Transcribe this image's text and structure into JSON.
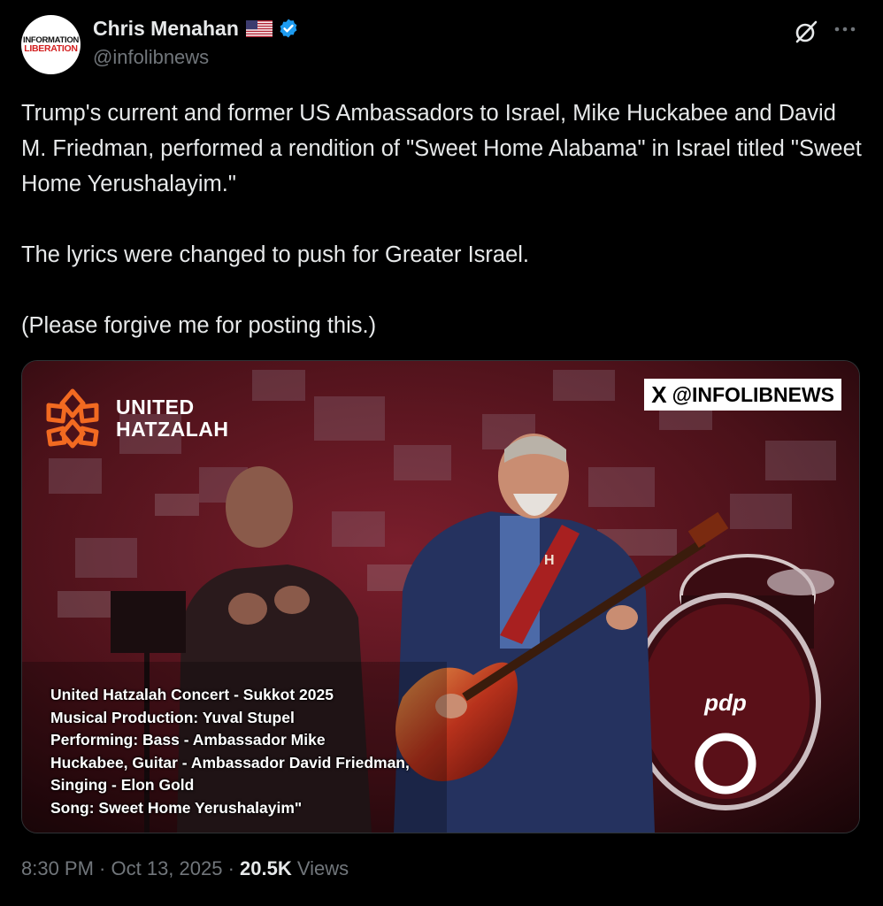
{
  "author": {
    "display_name": "Chris Menahan",
    "handle": "@infolibnews",
    "avatar_line1": "INFORMATION",
    "avatar_line2": "LIBERATION"
  },
  "tweet": {
    "text": "Trump's current and former US Ambassadors to Israel, Mike Huckabee and David M. Friedman, performed a rendition of \"Sweet Home Alabama\" in Israel titled \"Sweet Home Yerushalayim.\"\n\nThe lyrics were changed to push for Greater Israel.\n\n(Please forgive me for posting this.)"
  },
  "media": {
    "brand_line1": "UNITED",
    "brand_line2": "HATZALAH",
    "watermark": "@INFOLIBNEWS",
    "watermark_logo": "X",
    "drum_brand": "pdp",
    "strap_letter": "H",
    "caption_lines": [
      "United Hatzalah Concert - Sukkot 2025",
      "Musical Production: Yuval Stupel",
      "Performing: Bass - Ambassador Mike",
      "Huckabee, Guitar - Ambassador David Friedman,",
      "Singing - Elon Gold",
      "Song: Sweet Home Yerushalayim\""
    ]
  },
  "meta": {
    "time": "8:30 PM",
    "sep1": " · ",
    "date": "Oct 13, 2025",
    "sep2": " · ",
    "views_count": "20.5K",
    "views_label": " Views"
  },
  "icons": {
    "verified": "verified-badge-icon",
    "flag": "us-flag-icon",
    "grok": "grok-icon",
    "more": "more-icon"
  },
  "colors": {
    "background": "#000000",
    "text": "#e7e9ea",
    "secondary": "#71767b",
    "verified": "#1d9bf0",
    "brand_orange": "#f26a21"
  }
}
